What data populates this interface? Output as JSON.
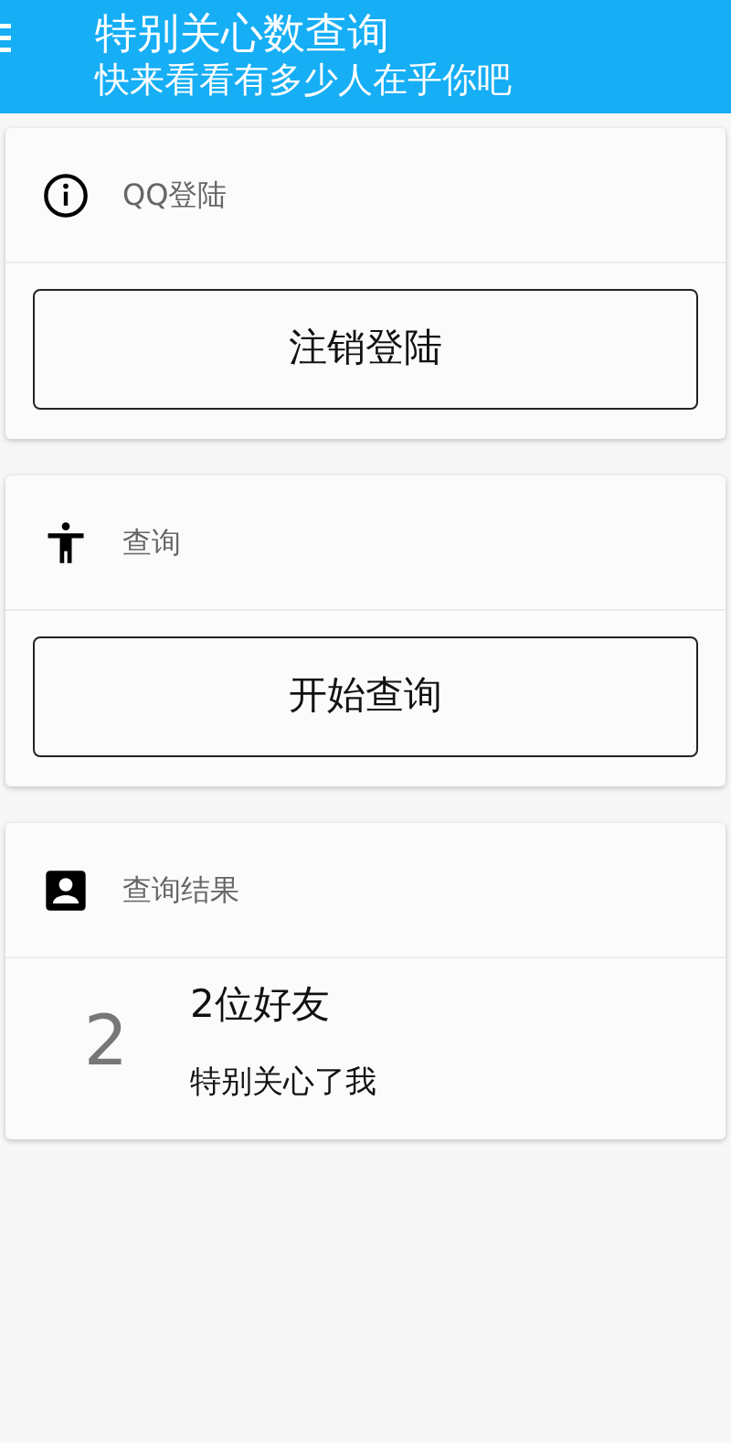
{
  "header": {
    "title": "特别关心数查询",
    "subtitle": "快来看看有多少人在乎你吧"
  },
  "cards": [
    {
      "kind": "action",
      "title": "QQ登陆",
      "button": "注销登陆"
    },
    {
      "kind": "action",
      "title": "查询",
      "button": "开始查询"
    },
    {
      "kind": "result",
      "title": "查询结果",
      "count": "2",
      "headline": "2位好友",
      "detail": "特别关心了我"
    }
  ]
}
